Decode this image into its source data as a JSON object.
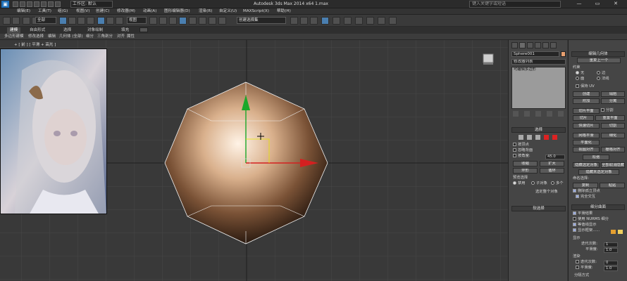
{
  "app": {
    "title": "Autodesk 3ds Max  2014 x64      1.max",
    "workspace": "工作区: 默认",
    "search_placeholder": "键入关键字或短语",
    "logo": "▣",
    "window_controls": [
      "—",
      "▭",
      "✕"
    ]
  },
  "menu": [
    "编辑(E)",
    "工具(T)",
    "组(G)",
    "视图(V)",
    "创建(C)",
    "修改器(M)",
    "动画(A)",
    "图形编辑器(D)",
    "渲染(R)",
    "自定义(U)",
    "MAXScript(X)",
    "帮助(H)"
  ],
  "toolbar": {
    "selection_filter": "全部",
    "ref_coord": "视图",
    "named_set": "创建选择集"
  },
  "ribbon": {
    "tabs": [
      "建模",
      "自由形式",
      "选择",
      "对象绘制",
      "填充"
    ],
    "subitems": [
      "多边形建模",
      "修改选择",
      "编辑",
      "几何体 (全部)",
      "细分",
      "三角剖分",
      "对齐",
      "属性"
    ]
  },
  "viewport": {
    "label": "+ [ 前 ] [ 平滑 + 高光 ]"
  },
  "modify_panel": {
    "object_name": "Sphere001",
    "object_color": "#e8a070",
    "modifier_list": "修改器列表",
    "stack_item": "可编辑多边形",
    "selection_header": "选择",
    "by_vertex": "按顶点",
    "ignore_backfacing": "忽略背面",
    "by_angle": "按角度:",
    "angle_value": "45.0",
    "shrink": "收缩",
    "grow": "扩大",
    "ring": "环形",
    "loop": "循环",
    "preview_header": "预览选择",
    "preview_off": "禁用",
    "preview_sub": "子对象",
    "preview_multi": "多个",
    "select_whole": "选定整个对象",
    "soft_selection": "软选择"
  },
  "edit_geometry": {
    "header": "编辑几何体",
    "repeat_last": "重复上一个",
    "constraints": "约束",
    "c_none": "无",
    "c_edge": "边",
    "c_face": "面",
    "c_normal": "法线",
    "preserve_uv": "保持 UV",
    "create": "创建",
    "collapse": "塌陷",
    "attach": "附加",
    "detach": "分离",
    "slice_plane": "切片平面",
    "split": "分割",
    "slice": "切片",
    "reset_plane": "重置平面",
    "quickslice": "快速切片",
    "cut": "切割",
    "meshsmooth": "网格平滑",
    "tessellate": "细化",
    "make_planar": "平面化",
    "view_align": "视图对齐",
    "grid_align": "栅格对齐",
    "relax": "松弛",
    "hide_selected": "隐藏选定对象",
    "unhide_all": "全部取消隐藏",
    "hide_unselected": "隐藏未选定对象",
    "named_header": "命名选择:",
    "copy": "复制",
    "paste": "粘贴",
    "delete_isolated": "删除孤立顶点",
    "full_interactivity": "完全交互"
  },
  "subdivision": {
    "header": "细分曲面",
    "smooth_result": "平滑结果",
    "use_nurms": "使用 NURMS 细分",
    "isoline": "等值线显示",
    "show_cage": "显示框架......",
    "display": "显示",
    "iterations": "迭代次数:",
    "iter_value": "1",
    "smoothness": "平滑度:",
    "smooth_value": "1.0",
    "render": "渲染",
    "r_iterations": "迭代次数:",
    "r_iter_value": "0",
    "r_smoothness": "平滑度:",
    "r_smooth_value": "1.0",
    "sep_header": "分隔方式"
  },
  "colors": {
    "accent": "#4a78ac",
    "cage1": "#e6a030",
    "cage2": "#f0d060",
    "gizmo_y": "#1aa82a",
    "gizmo_x": "#d42020"
  }
}
